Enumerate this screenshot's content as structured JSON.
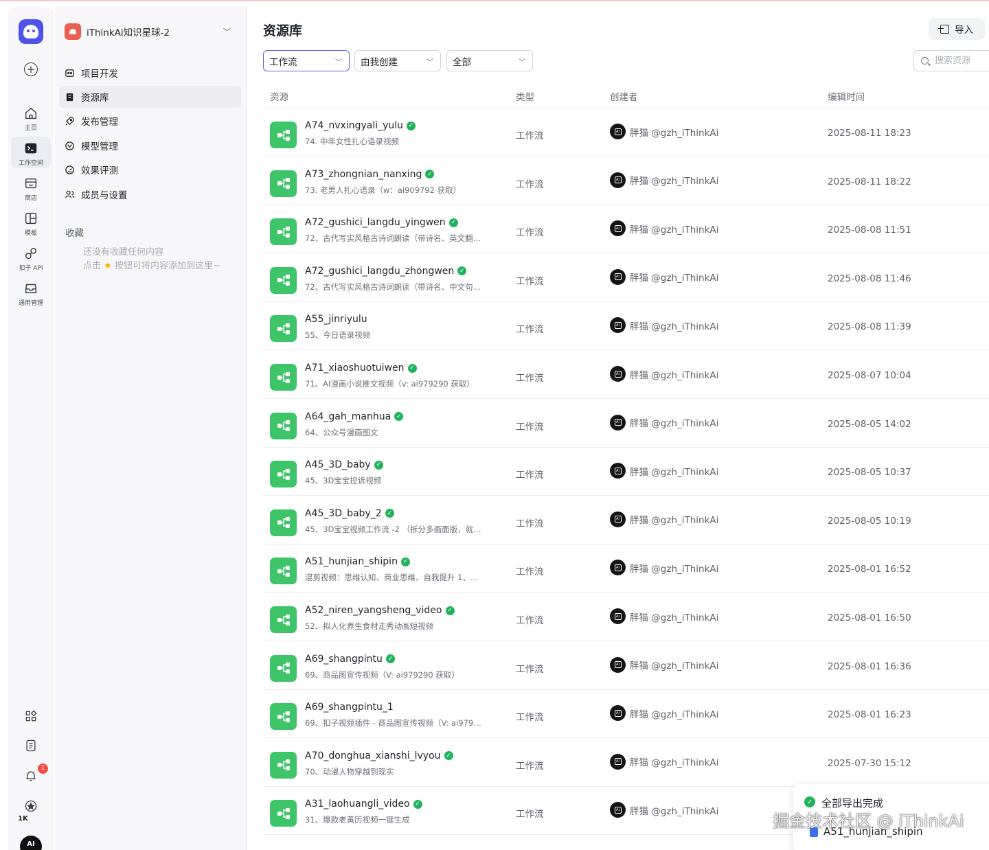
{
  "rail": {
    "items": [
      {
        "label": "主页",
        "icon": "home-icon"
      },
      {
        "label": "工作空间",
        "icon": "terminal-icon"
      },
      {
        "label": "商店",
        "icon": "store-icon"
      },
      {
        "label": "模板",
        "icon": "layout-icon"
      },
      {
        "label": "扣子 API",
        "icon": "link-icon"
      },
      {
        "label": "通用管理",
        "icon": "inbox-icon"
      }
    ],
    "notification_count": "1",
    "star_count": "1K",
    "avatar_text": "AI"
  },
  "sidebar": {
    "space_name": "iThinkAi知识星球-2",
    "nav": [
      {
        "label": "项目开发",
        "icon": "project-icon"
      },
      {
        "label": "资源库",
        "icon": "library-icon"
      },
      {
        "label": "发布管理",
        "icon": "rocket-icon"
      },
      {
        "label": "模型管理",
        "icon": "model-icon"
      },
      {
        "label": "效果评测",
        "icon": "gauge-icon"
      },
      {
        "label": "成员与设置",
        "icon": "members-icon"
      }
    ],
    "favorites_title": "收藏",
    "favorites_empty_line1": "还没有收藏任何内容",
    "favorites_empty_line2_prefix": "点击",
    "favorites_empty_line2_suffix": "按钮可将内容添加到这里~"
  },
  "header": {
    "title": "资源库",
    "import_label": "导入"
  },
  "filters": {
    "type": "工作流",
    "creator": "由我创建",
    "status": "全部",
    "search_placeholder": "搜索资源"
  },
  "table": {
    "columns": [
      "资源",
      "类型",
      "创建者",
      "编辑时间"
    ],
    "rows": [
      {
        "name": "A74_nvxingyali_yulu",
        "verified": true,
        "desc": "74. 中年女性扎心语录视频",
        "type": "工作流",
        "creator": "胖猫 @gzh_iThinkAi",
        "time": "2025-08-11 18:23"
      },
      {
        "name": "A73_zhongnian_nanxing",
        "verified": true,
        "desc": "73. 老男人扎心语录（w：ai909792 获取）",
        "type": "工作流",
        "creator": "胖猫 @gzh_iThinkAi",
        "time": "2025-08-11 18:22"
      },
      {
        "name": "A72_gushici_langdu_yingwen",
        "verified": true,
        "desc": "72、古代写实风格古诗词朗读（带诗名、英文翻…",
        "type": "工作流",
        "creator": "胖猫 @gzh_iThinkAi",
        "time": "2025-08-08 11:51"
      },
      {
        "name": "A72_gushici_langdu_zhongwen",
        "verified": true,
        "desc": "72、古代写实风格古诗词朗读（带诗名、中文句…",
        "type": "工作流",
        "creator": "胖猫 @gzh_iThinkAi",
        "time": "2025-08-08 11:46"
      },
      {
        "name": "A55_jinriyulu",
        "verified": false,
        "desc": "55、今日语录视频",
        "type": "工作流",
        "creator": "胖猫 @gzh_iThinkAi",
        "time": "2025-08-08 11:39"
      },
      {
        "name": "A71_xiaoshuotuiwen",
        "verified": true,
        "desc": "71、AI漫画小说推文视频（v: ai979290 获取）",
        "type": "工作流",
        "creator": "胖猫 @gzh_iThinkAi",
        "time": "2025-08-07 10:04"
      },
      {
        "name": "A64_gah_manhua",
        "verified": true,
        "desc": "64、公众号漫画图文",
        "type": "工作流",
        "creator": "胖猫 @gzh_iThinkAi",
        "time": "2025-08-05 14:02"
      },
      {
        "name": "A45_3D_baby",
        "verified": true,
        "desc": "45、3D宝宝控诉视频",
        "type": "工作流",
        "creator": "胖猫 @gzh_iThinkAi",
        "time": "2025-08-05 10:37"
      },
      {
        "name": "A45_3D_baby_2",
        "verified": true,
        "desc": "45、3D宝宝视频工作流 -2 （拆分多画面版，就…",
        "type": "工作流",
        "creator": "胖猫 @gzh_iThinkAi",
        "time": "2025-08-05 10:19"
      },
      {
        "name": "A51_hunjian_shipin",
        "verified": true,
        "desc": "混剪视频：思维认知、商业思维、自我提升 1、…",
        "type": "工作流",
        "creator": "胖猫 @gzh_iThinkAi",
        "time": "2025-08-01 16:52"
      },
      {
        "name": "A52_niren_yangsheng_video",
        "verified": true,
        "desc": "52、拟人化养生食材走秀动画短视频",
        "type": "工作流",
        "creator": "胖猫 @gzh_iThinkAi",
        "time": "2025-08-01 16:50"
      },
      {
        "name": "A69_shangpintu",
        "verified": true,
        "desc": "69、商品图宣传视频（V: ai979290 获取）",
        "type": "工作流",
        "creator": "胖猫 @gzh_iThinkAi",
        "time": "2025-08-01 16:36"
      },
      {
        "name": "A69_shangpintu_1",
        "verified": false,
        "desc": "69、扣子视频插件 - 商品图宣传视频（V: ai979…",
        "type": "工作流",
        "creator": "胖猫 @gzh_iThinkAi",
        "time": "2025-08-01 16:23"
      },
      {
        "name": "A70_donghua_xianshi_lvyou",
        "verified": true,
        "desc": "70、动漫人物穿越到现实",
        "type": "工作流",
        "creator": "胖猫 @gzh_iThinkAi",
        "time": "2025-07-30 15:12"
      },
      {
        "name": "A31_laohuangli_video",
        "verified": true,
        "desc": "31、爆款老黄历视频一键生成",
        "type": "工作流",
        "creator": "胖猫 @gzh_iThinkAi",
        "time": ""
      }
    ]
  },
  "toast": {
    "title": "全部导出完成",
    "file": "A51_hunjian_shipin"
  },
  "watermark": "掘金技术社区 @ iThinkAi",
  "colors": {
    "accent": "#4d53e8",
    "workflow_icon": "#3ec56a",
    "verified": "#21b35c",
    "badge": "#f54a45"
  }
}
